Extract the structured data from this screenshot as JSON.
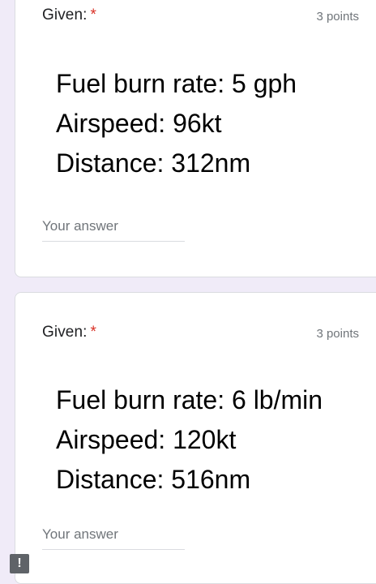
{
  "questions": [
    {
      "title": "Given:",
      "required_marker": "*",
      "points": "3 points",
      "image_lines": [
        "Fuel burn rate: 5 gph",
        "Airspeed: 96kt",
        "Distance: 312nm"
      ],
      "answer_placeholder": "Your answer"
    },
    {
      "title": "Given:",
      "required_marker": "*",
      "points": "3 points",
      "image_lines": [
        "Fuel burn rate: 6 lb/min",
        "Airspeed: 120kt",
        "Distance: 516nm"
      ],
      "answer_placeholder": "Your answer"
    }
  ],
  "report_icon_glyph": "!",
  "colors": {
    "background": "#f0ebf8",
    "required": "#d93025",
    "muted_text": "#70757a",
    "card_border": "#dadce0"
  }
}
